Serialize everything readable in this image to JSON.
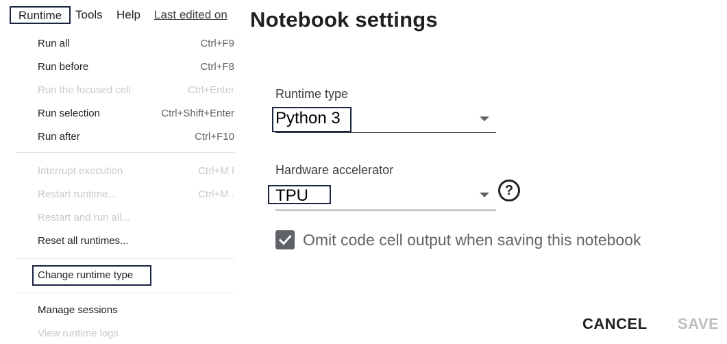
{
  "menubar": {
    "runtime": "Runtime",
    "tools": "Tools",
    "help": "Help",
    "last_edited": "Last edited on"
  },
  "runtime_menu": {
    "items": [
      {
        "label": "Run all",
        "shortcut": "Ctrl+F9",
        "disabled": false
      },
      {
        "label": "Run before",
        "shortcut": "Ctrl+F8",
        "disabled": false
      },
      {
        "label": "Run the focused cell",
        "shortcut": "Ctrl+Enter",
        "disabled": true
      },
      {
        "label": "Run selection",
        "shortcut": "Ctrl+Shift+Enter",
        "disabled": false
      },
      {
        "label": "Run after",
        "shortcut": "Ctrl+F10",
        "disabled": false
      },
      {
        "label": "Interrupt execution",
        "shortcut": "Ctrl+M I",
        "disabled": true
      },
      {
        "label": "Restart runtime...",
        "shortcut": "Ctrl+M .",
        "disabled": true
      },
      {
        "label": "Restart and run all...",
        "shortcut": "",
        "disabled": true
      },
      {
        "label": "Reset all runtimes...",
        "shortcut": "",
        "disabled": false
      },
      {
        "label": "Change runtime type",
        "shortcut": "",
        "disabled": false
      },
      {
        "label": "Manage sessions",
        "shortcut": "",
        "disabled": false
      },
      {
        "label": "View runtime logs",
        "shortcut": "",
        "disabled": true
      }
    ]
  },
  "dialog": {
    "title": "Notebook settings",
    "runtime_type_label": "Runtime type",
    "runtime_type_value": "Python 3",
    "hardware_label": "Hardware accelerator",
    "hardware_value": "TPU",
    "help_icon": "?",
    "omit_output_label": "Omit code cell output when saving this notebook",
    "omit_output_checked": true,
    "cancel_label": "CANCEL",
    "save_label": "SAVE"
  },
  "icons": {
    "dropdown": "caret-down-icon",
    "help": "help-circle-icon",
    "checkbox": "check-icon"
  },
  "colors": {
    "highlight_box": "#1a2440",
    "disabled_text": "#c7c9cc",
    "checkbox_fill": "#5f6368",
    "save_disabled": "#bdbdbd"
  }
}
